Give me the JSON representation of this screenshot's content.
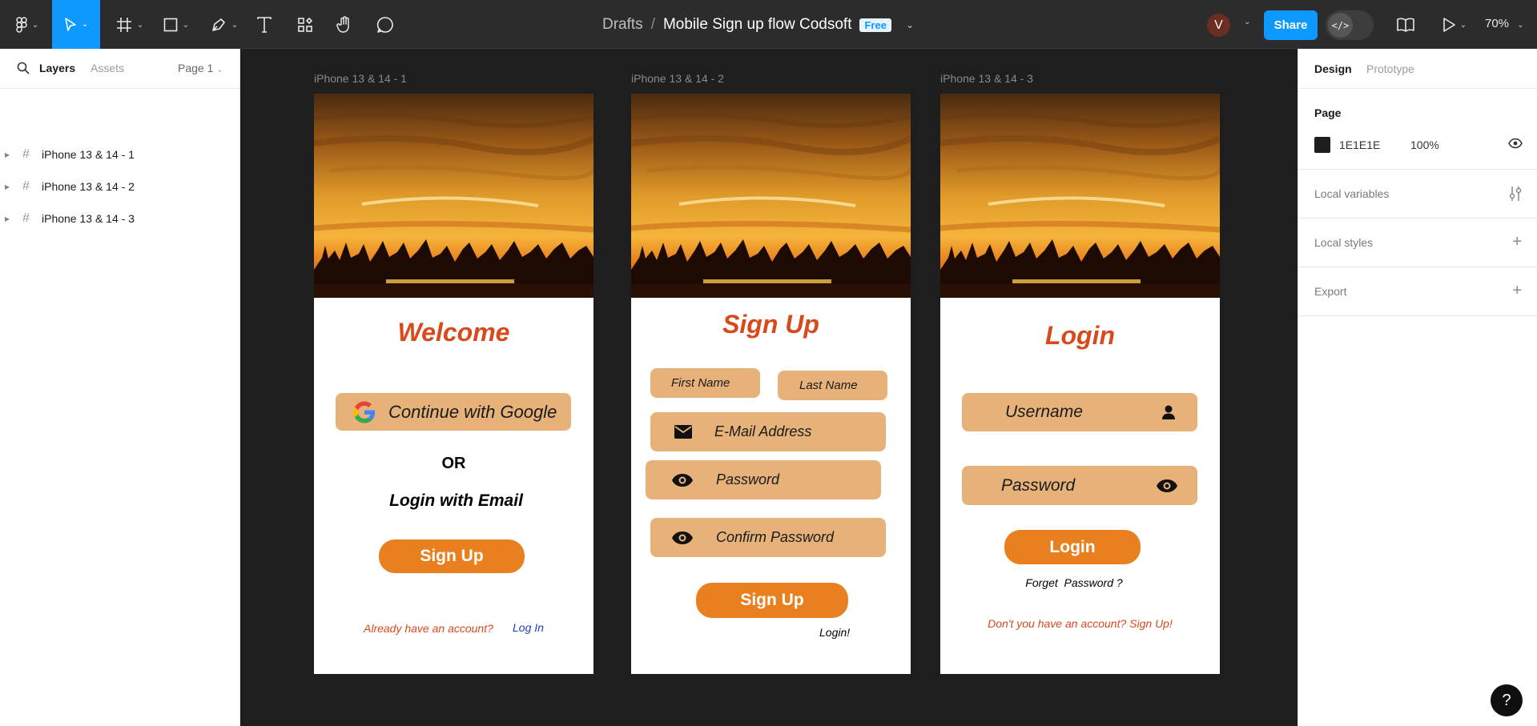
{
  "toolbar": {
    "file_breadcrumb": "Drafts",
    "file_separator": "/",
    "file_title": "Mobile Sign up flow Codsoft",
    "plan_badge": "Free",
    "avatar_initial": "V",
    "share_label": "Share",
    "dev_mode_icon": "</>",
    "zoom": "70%",
    "tools": [
      "main-menu-icon",
      "move-icon",
      "frame-icon",
      "rectangle-icon",
      "pen-icon",
      "text-icon",
      "resources-icon",
      "hand-icon",
      "comment-icon"
    ]
  },
  "left_panel": {
    "tabs": [
      "Layers",
      "Assets"
    ],
    "page_selector": "Page 1",
    "layers": [
      {
        "label": "iPhone 13 & 14 - 1"
      },
      {
        "label": "iPhone 13 & 14 - 2"
      },
      {
        "label": "iPhone 13 & 14 - 3"
      }
    ]
  },
  "right_panel": {
    "tabs": [
      "Design",
      "Prototype"
    ],
    "page_section": {
      "title": "Page",
      "color_hex": "1E1E1E",
      "opacity": "100%"
    },
    "sections": [
      "Local variables",
      "Local styles",
      "Export"
    ]
  },
  "help_label": "?",
  "frames": [
    {
      "label": "iPhone 13 & 14 - 1",
      "heading": "Welcome",
      "google_button": "Continue with Google",
      "or_text": "OR",
      "email_text": "Login with Email",
      "signup_button": "Sign Up",
      "footer_prompt": "Already have an account?",
      "footer_link": "Log In"
    },
    {
      "label": "iPhone 13 & 14 - 2",
      "heading": "Sign Up",
      "first_name": "First Name",
      "last_name": "Last Name",
      "email": "E-Mail Address",
      "password": "Password",
      "confirm_password": "Confirm Password",
      "signup_button": "Sign Up",
      "login_link": "Login!"
    },
    {
      "label": "iPhone 13 & 14 - 3",
      "heading": "Login",
      "username": "Username",
      "password": "Password",
      "login_button": "Login",
      "forgot": "Forget  Password ?",
      "footer": "Don't you have an account? Sign Up!"
    }
  ],
  "colors": {
    "accent": "#0d99ff",
    "heading_red": "#d84a1b",
    "field_tan": "#e6b27a",
    "button_orange": "#e8801f",
    "link_blue": "#1a3fc4",
    "canvas_bg": "#1e1e1e"
  }
}
